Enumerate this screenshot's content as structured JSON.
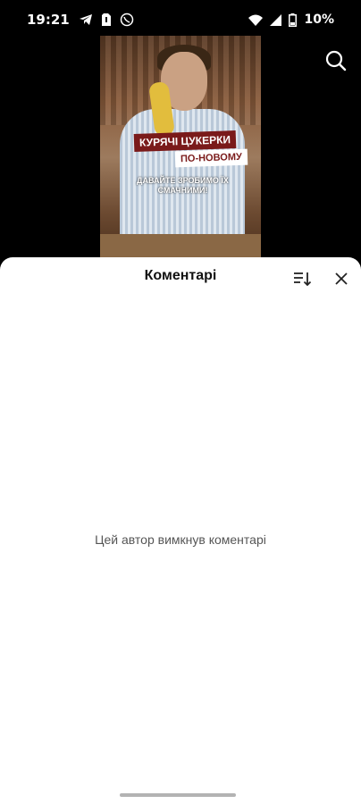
{
  "status_bar": {
    "time": "19:21",
    "battery_text": "10%",
    "icons": [
      "telegram-icon",
      "sim-icon",
      "viber-icon",
      "wifi-icon",
      "signal-icon",
      "battery-icon"
    ]
  },
  "video": {
    "overlay_title": "КУРЯЧІ ЦУКЕРКИ",
    "overlay_sub": "ПО-НОВОМУ",
    "overlay_caption": "ДАВАЙТЕ ЗРОБИМО ЇХ СМАЧНИМИ!"
  },
  "comments_sheet": {
    "title": "Коментарі",
    "empty_message": "Цей автор вимкнув коментарі"
  },
  "colors": {
    "sheet_bg": "#ffffff",
    "overlay_red": "#7a1a1a",
    "text_secondary": "#555555"
  }
}
